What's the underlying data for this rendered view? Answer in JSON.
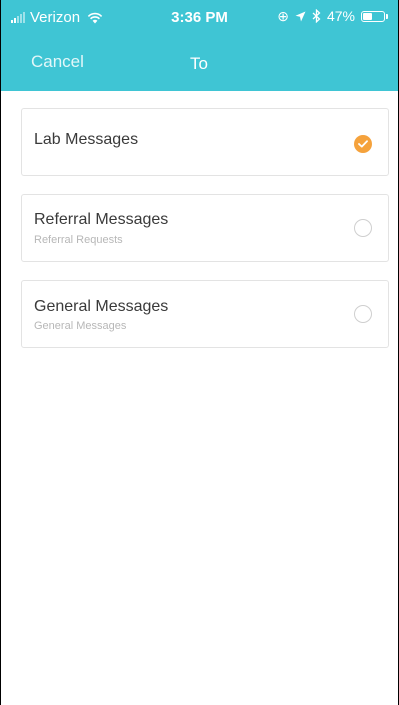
{
  "status_bar": {
    "carrier": "Verizon",
    "time": "3:36 PM",
    "battery_percent_label": "47%",
    "battery_level": 0.47,
    "icons": [
      "signal-icon",
      "wifi-icon",
      "orientation-lock-icon",
      "location-arrow-icon",
      "bluetooth-icon",
      "battery-icon"
    ]
  },
  "nav": {
    "cancel_label": "Cancel",
    "title": "To"
  },
  "options": [
    {
      "title": "Lab Messages",
      "subtitle": "",
      "selected": true
    },
    {
      "title": "Referral Messages",
      "subtitle": "Referral Requests",
      "selected": false
    },
    {
      "title": "General Messages",
      "subtitle": "General Messages",
      "selected": false
    }
  ],
  "colors": {
    "header": "#3fc5d4",
    "selected_accent": "#f5a23c",
    "card_border": "#e3e3e3"
  }
}
